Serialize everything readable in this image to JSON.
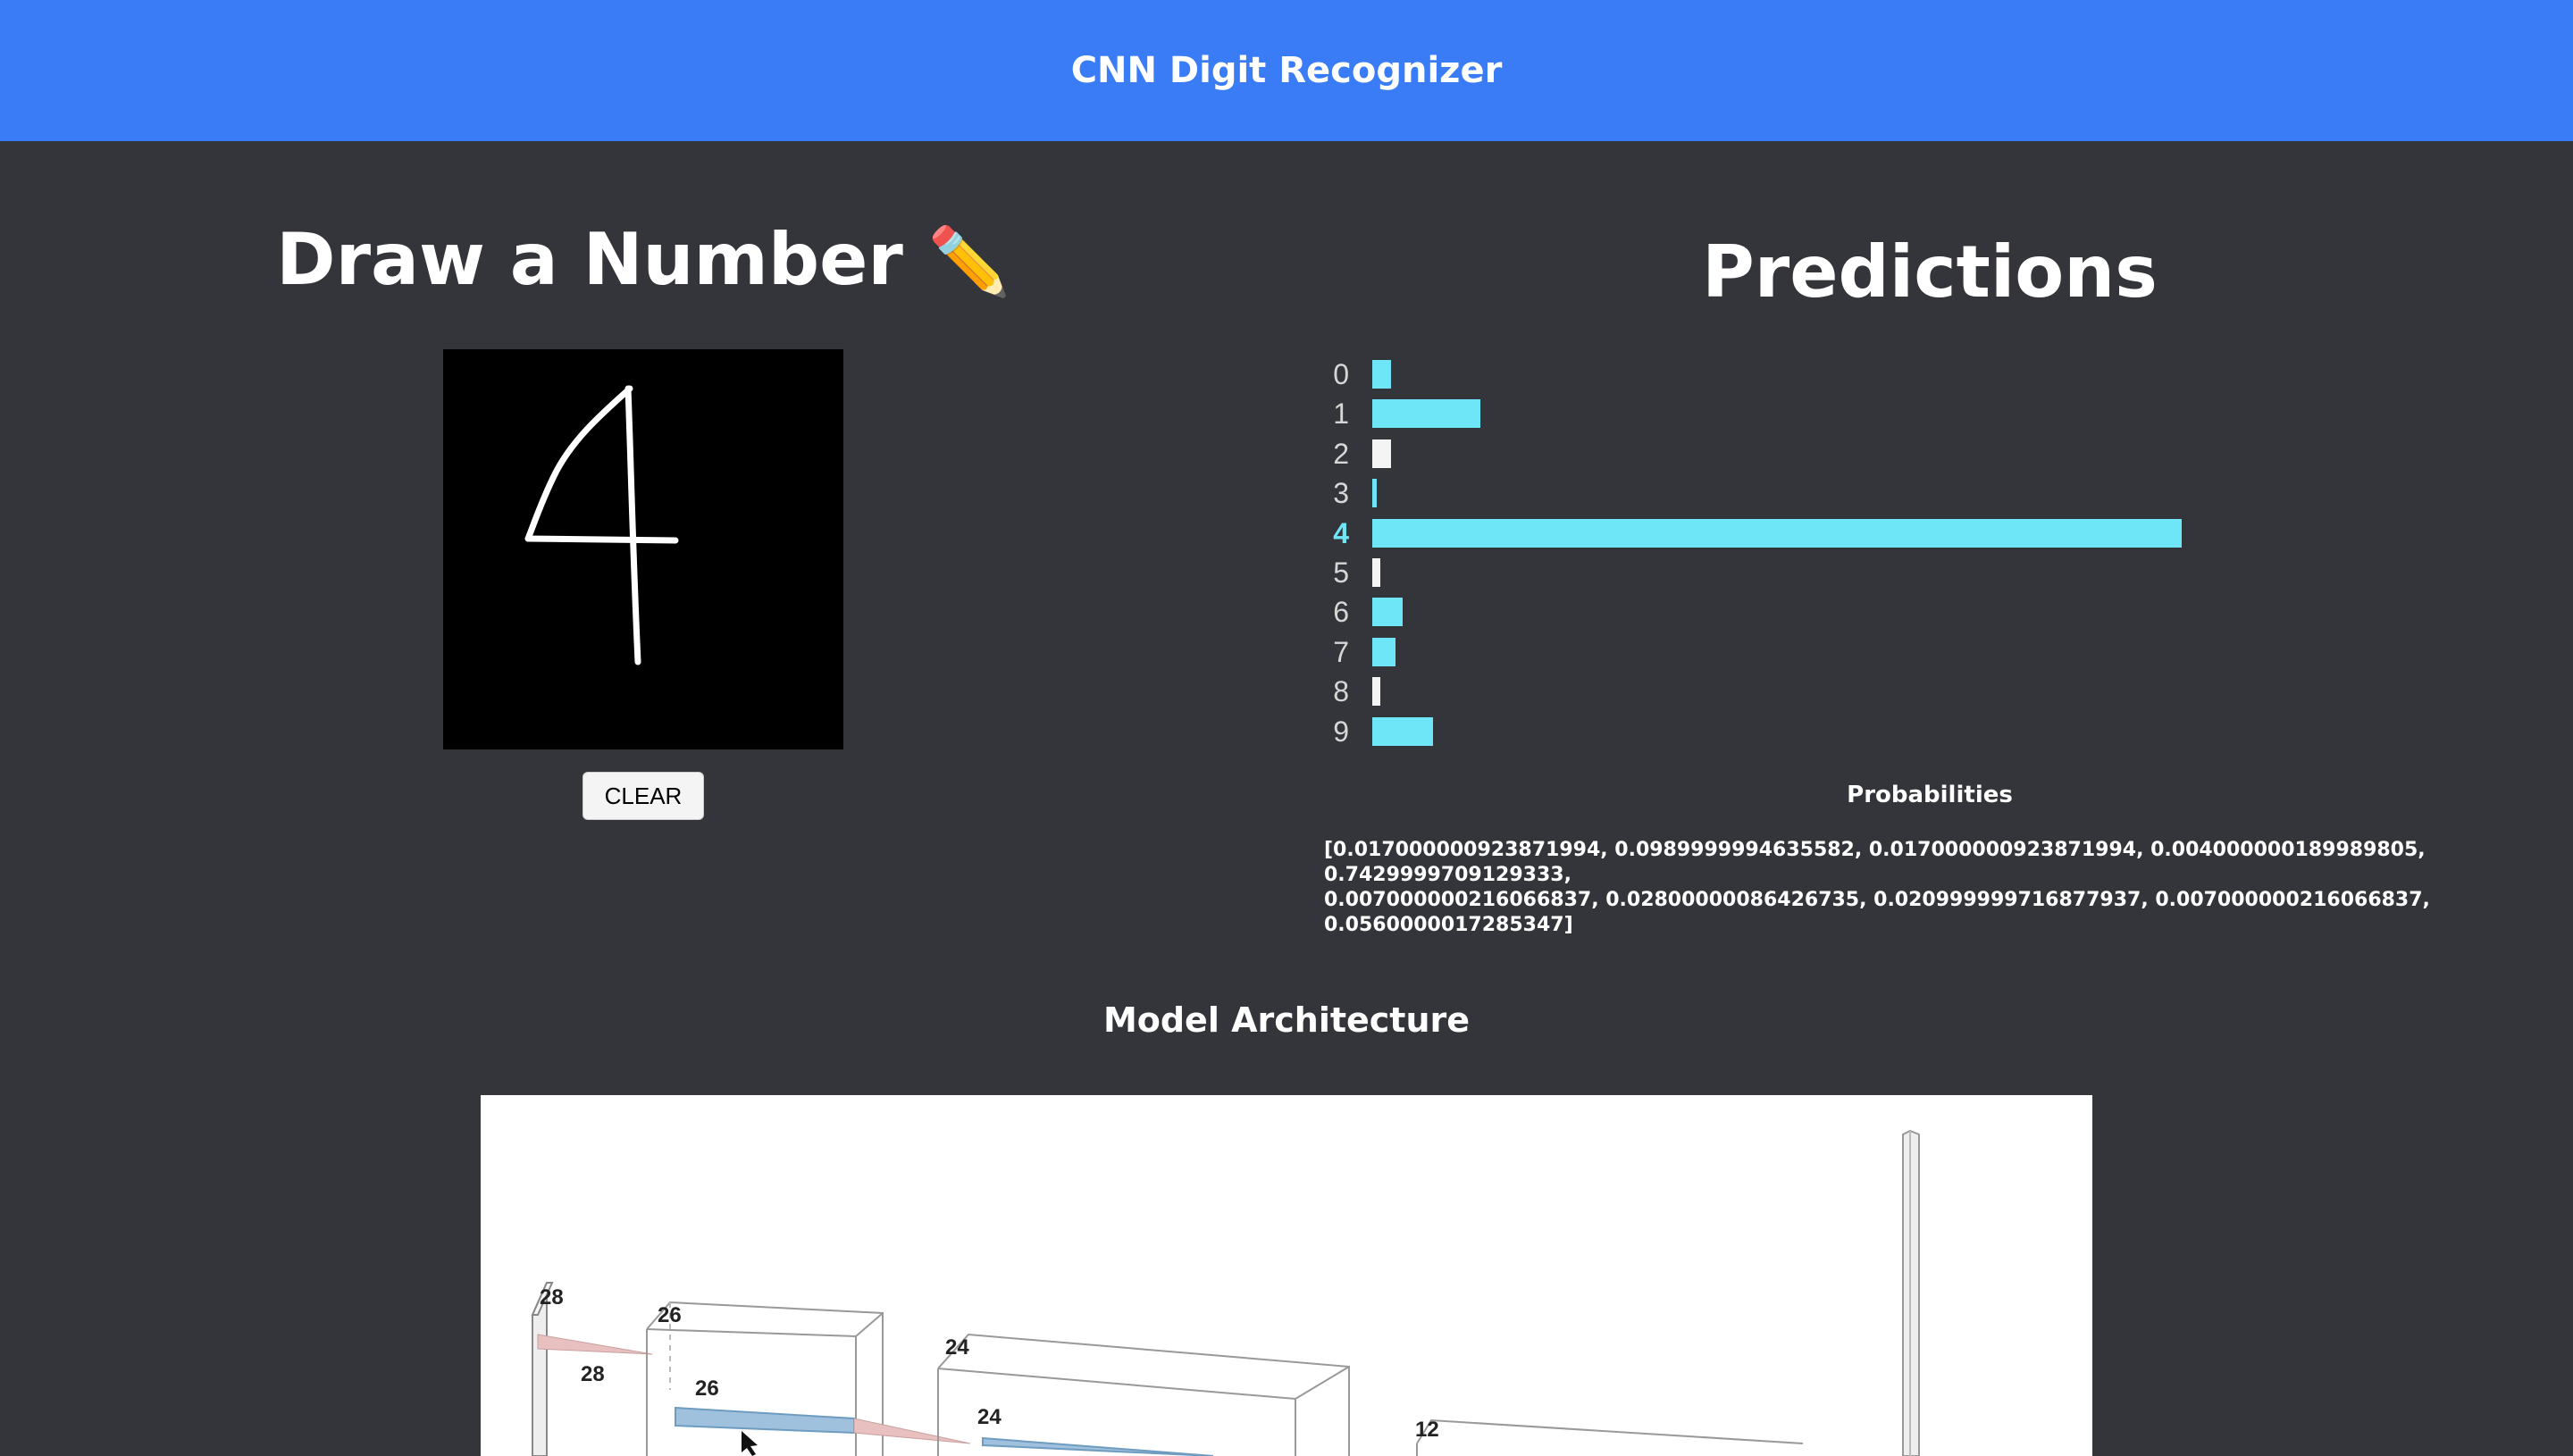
{
  "header": {
    "title": "CNN Digit Recognizer"
  },
  "draw_panel": {
    "title": "Draw a Number",
    "title_icon": "✏️",
    "clear_label": "CLEAR"
  },
  "predictions_panel": {
    "title": "Predictions",
    "bars": [
      {
        "label": "0",
        "value": 0.017,
        "color": "#6ee6f8"
      },
      {
        "label": "1",
        "value": 0.099,
        "color": "#6ee6f8"
      },
      {
        "label": "2",
        "value": 0.017,
        "color": "#f4f4f4"
      },
      {
        "label": "3",
        "value": 0.004,
        "color": "#6ee6f8"
      },
      {
        "label": "4",
        "value": 0.743,
        "color": "#6ee6f8",
        "highlight": true
      },
      {
        "label": "5",
        "value": 0.007,
        "color": "#f4f4f4"
      },
      {
        "label": "6",
        "value": 0.028,
        "color": "#6ee6f8"
      },
      {
        "label": "7",
        "value": 0.021,
        "color": "#6ee6f8"
      },
      {
        "label": "8",
        "value": 0.007,
        "color": "#f4f4f4"
      },
      {
        "label": "9",
        "value": 0.056,
        "color": "#6ee6f8"
      }
    ],
    "probabilities_title": "Probabilities",
    "probabilities_text": "[0.017000000923871994, 0.0989999994635582, 0.017000000923871994, 0.004000000189989805, 0.7429999709129333,\n0.007000000216066837, 0.02800000086426735, 0.020999999716877937, 0.007000000216066837, 0.0560000017285347]"
  },
  "architecture": {
    "title": "Model Architecture",
    "layer_labels": [
      "28",
      "28",
      "26",
      "26",
      "24",
      "24",
      "12"
    ]
  },
  "colors": {
    "header_bg": "#3a7cf5",
    "page_bg": "#34353a",
    "bar_cyan": "#6ee6f8",
    "bar_white": "#f4f4f4"
  }
}
